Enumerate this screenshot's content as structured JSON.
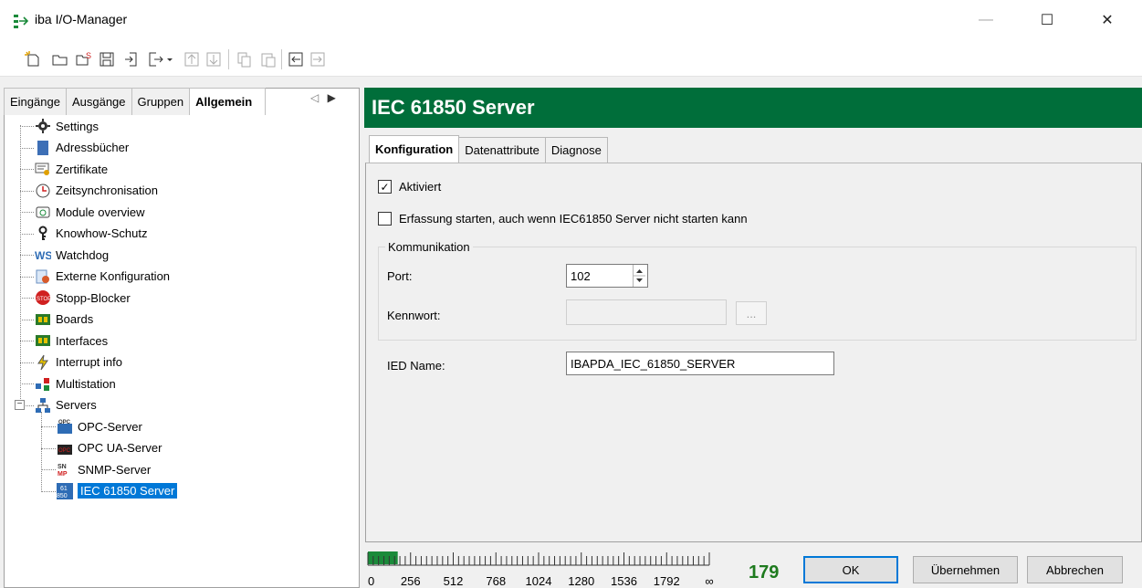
{
  "window": {
    "title": "iba I/O-Manager"
  },
  "toolbar": {
    "buttons": [
      "new-icon",
      "open-icon",
      "open-special-icon",
      "save-icon",
      "import-icon",
      "export-icon",
      "dropdown-icon",
      "up-icon",
      "down-icon",
      "copy-icon",
      "paste-icon",
      "move-left-icon",
      "move-right-icon"
    ]
  },
  "left": {
    "tabs": [
      "Eingänge",
      "Ausgänge",
      "Gruppen",
      "Allgemein"
    ],
    "active_tab": "Allgemein",
    "tree": [
      {
        "label": "Settings",
        "icon": "gear-icon"
      },
      {
        "label": "Adressbücher",
        "icon": "address-book-icon"
      },
      {
        "label": "Zertifikate",
        "icon": "certificate-icon"
      },
      {
        "label": "Zeitsynchronisation",
        "icon": "clock-icon"
      },
      {
        "label": "Module overview",
        "icon": "module-overview-icon"
      },
      {
        "label": "Knowhow-Schutz",
        "icon": "key-icon"
      },
      {
        "label": "Watchdog",
        "icon": "watchdog-icon"
      },
      {
        "label": "Externe Konfiguration",
        "icon": "external-config-icon"
      },
      {
        "label": "Stopp-Blocker",
        "icon": "stop-icon"
      },
      {
        "label": "Boards",
        "icon": "board-icon"
      },
      {
        "label": "Interfaces",
        "icon": "interface-icon"
      },
      {
        "label": "Interrupt info",
        "icon": "interrupt-icon"
      },
      {
        "label": "Multistation",
        "icon": "multistation-icon"
      },
      {
        "label": "Servers",
        "icon": "servers-icon",
        "expanded": true
      },
      {
        "label": "OPC-Server",
        "icon": "opc-icon",
        "child": true
      },
      {
        "label": "OPC UA-Server",
        "icon": "opc-ua-icon",
        "child": true
      },
      {
        "label": "SNMP-Server",
        "icon": "snmp-icon",
        "child": true
      },
      {
        "label": "IEC 61850 Server",
        "icon": "iec61850-icon",
        "child": true,
        "selected": true
      }
    ]
  },
  "right": {
    "header": "IEC 61850 Server",
    "tabs": [
      "Konfiguration",
      "Datenattribute",
      "Diagnose"
    ],
    "active_tab": "Konfiguration",
    "aktiviert_label": "Aktiviert",
    "aktiviert_checked": true,
    "erfassung_label": "Erfassung starten, auch wenn IEC61850 Server nicht starten kann",
    "erfassung_checked": false,
    "group_title": "Kommunikation",
    "port_label": "Port:",
    "port_value": "102",
    "kennwort_label": "Kennwort:",
    "kennwort_value": "",
    "browse_label": "...",
    "ied_label": "IED Name:",
    "ied_value": "IBAPDA_IEC_61850_SERVER"
  },
  "footer": {
    "gauge_ticks": [
      "0",
      "256",
      "512",
      "768",
      "1024",
      "1280",
      "1536",
      "1792",
      "∞"
    ],
    "gauge_value": 179,
    "count": "179",
    "ok_label": "OK",
    "apply_label": "Übernehmen",
    "cancel_label": "Abbrechen"
  },
  "colors": {
    "header_bg": "#006e3a",
    "selection": "#0078d7",
    "count_text": "#1e7a1e"
  }
}
